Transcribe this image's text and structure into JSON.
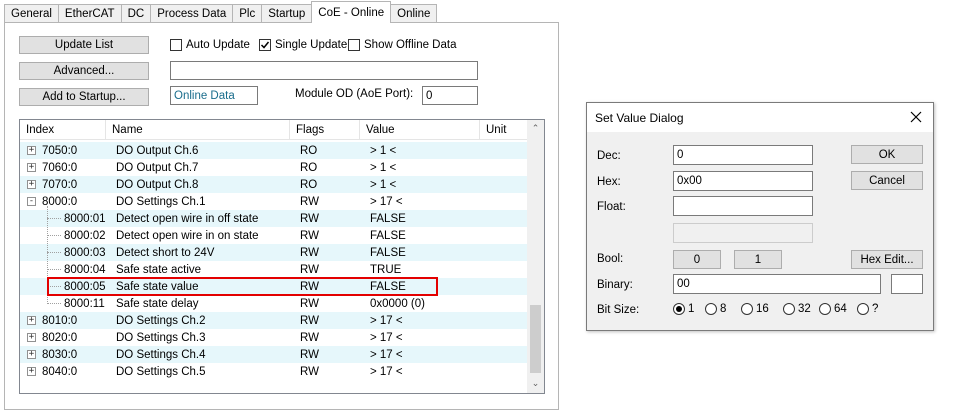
{
  "tabs": [
    {
      "label": "General"
    },
    {
      "label": "EtherCAT"
    },
    {
      "label": "DC"
    },
    {
      "label": "Process Data"
    },
    {
      "label": "Plc"
    },
    {
      "label": "Startup"
    },
    {
      "label": "CoE - Online"
    },
    {
      "label": "Online"
    }
  ],
  "active_tab": "CoE - Online",
  "buttons": {
    "update_list": "Update List",
    "advanced": "Advanced...",
    "add_to_startup": "Add to Startup..."
  },
  "checkboxes": {
    "auto_update": {
      "label": "Auto Update",
      "checked": false
    },
    "single_update": {
      "label": "Single Update",
      "checked": true
    },
    "show_offline": {
      "label": "Show Offline Data",
      "checked": false
    }
  },
  "fields": {
    "advanced_value": "",
    "mode_value": "Online Data",
    "module_od_label": "Module OD (AoE Port):",
    "module_od_value": "0"
  },
  "table": {
    "headers": [
      "Index",
      "Name",
      "Flags",
      "Value",
      "Unit"
    ],
    "rows": [
      {
        "index": "7050:0",
        "name": "DO Output Ch.6",
        "flags": "RO",
        "value": "> 1 <",
        "level": 0,
        "expander": "+"
      },
      {
        "index": "7060:0",
        "name": "DO Output Ch.7",
        "flags": "RO",
        "value": "> 1 <",
        "level": 0,
        "expander": "+"
      },
      {
        "index": "7070:0",
        "name": "DO Output Ch.8",
        "flags": "RO",
        "value": "> 1 <",
        "level": 0,
        "expander": "+"
      },
      {
        "index": "8000:0",
        "name": "DO Settings Ch.1",
        "flags": "RW",
        "value": "> 17 <",
        "level": 0,
        "expander": "-"
      },
      {
        "index": "8000:01",
        "name": "Detect open wire in off state",
        "flags": "RW",
        "value": "FALSE",
        "level": 1,
        "expander": ""
      },
      {
        "index": "8000:02",
        "name": "Detect open wire in on state",
        "flags": "RW",
        "value": "FALSE",
        "level": 1,
        "expander": ""
      },
      {
        "index": "8000:03",
        "name": "Detect short to 24V",
        "flags": "RW",
        "value": "FALSE",
        "level": 1,
        "expander": ""
      },
      {
        "index": "8000:04",
        "name": "Safe state active",
        "flags": "RW",
        "value": "TRUE",
        "level": 1,
        "expander": ""
      },
      {
        "index": "8000:05",
        "name": "Safe state value",
        "flags": "RW",
        "value": "FALSE",
        "level": 1,
        "expander": ""
      },
      {
        "index": "8000:11",
        "name": "Safe state delay",
        "flags": "RW",
        "value": "0x0000 (0)",
        "level": 1,
        "expander": ""
      },
      {
        "index": "8010:0",
        "name": "DO Settings Ch.2",
        "flags": "RW",
        "value": "> 17 <",
        "level": 0,
        "expander": "+"
      },
      {
        "index": "8020:0",
        "name": "DO Settings Ch.3",
        "flags": "RW",
        "value": "> 17 <",
        "level": 0,
        "expander": "+"
      },
      {
        "index": "8030:0",
        "name": "DO Settings Ch.4",
        "flags": "RW",
        "value": "> 17 <",
        "level": 0,
        "expander": "+"
      },
      {
        "index": "8040:0",
        "name": "DO Settings Ch.5",
        "flags": "RW",
        "value": "> 17 <",
        "level": 0,
        "expander": "+"
      }
    ]
  },
  "highlight_color": "#e30000",
  "row_alt_color": "#e6f7fb",
  "dialog": {
    "title": "Set Value Dialog",
    "labels": {
      "dec": "Dec:",
      "hex": "Hex:",
      "float": "Float:",
      "bool": "Bool:",
      "binary": "Binary:",
      "bit_size": "Bit Size:"
    },
    "values": {
      "dec": "0",
      "hex": "0x00",
      "float": "",
      "float2": "",
      "binary": "00"
    },
    "buttons": {
      "ok": "OK",
      "cancel": "Cancel",
      "bool_0": "0",
      "bool_1": "1",
      "hex_edit": "Hex Edit..."
    },
    "bit_sizes": [
      "1",
      "8",
      "16",
      "32",
      "64",
      "?"
    ],
    "bit_size_selected": "1"
  }
}
